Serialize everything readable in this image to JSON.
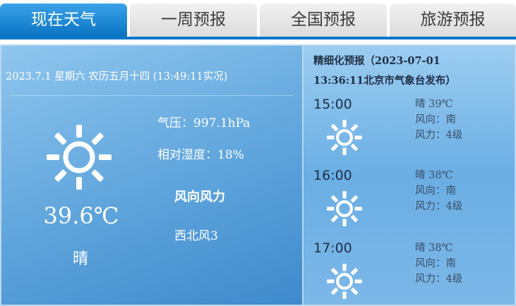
{
  "tabs": [
    {
      "label": "现在天气",
      "active": true
    },
    {
      "label": "一周预报",
      "active": false
    },
    {
      "label": "全国预报",
      "active": false
    },
    {
      "label": "旅游预报",
      "active": false
    }
  ],
  "current": {
    "date_line": "2023.7.1 星期六  农历五月十四 (13:49:11实况)",
    "icon": "sun-icon",
    "temperature": "39.6℃",
    "condition": "晴",
    "pressure": "气压：997.1hPa",
    "humidity": "相对湿度：18%",
    "wind_title": "风向风力",
    "wind_value": "西北风3"
  },
  "forecast": {
    "title_line1": "精细化预报（2023-07-01",
    "title_line2": "13:36:11北京市气象台发布）",
    "hours": [
      {
        "time": "15:00",
        "condition_temp": "晴  39℃",
        "direction": "风向：南",
        "force": "风力：4级",
        "icon": "sun-icon"
      },
      {
        "time": "16:00",
        "condition_temp": "晴  38℃",
        "direction": "风向：南",
        "force": "风力：4级",
        "icon": "sun-icon"
      },
      {
        "time": "17:00",
        "condition_temp": "晴  38℃",
        "direction": "风向：南",
        "force": "风力：4级",
        "icon": "sun-icon"
      }
    ]
  },
  "colors": {
    "tab_active": "#0a74c4",
    "tab_inactive": "#e6e6e6",
    "panel_blue": "#5ea4dc"
  }
}
